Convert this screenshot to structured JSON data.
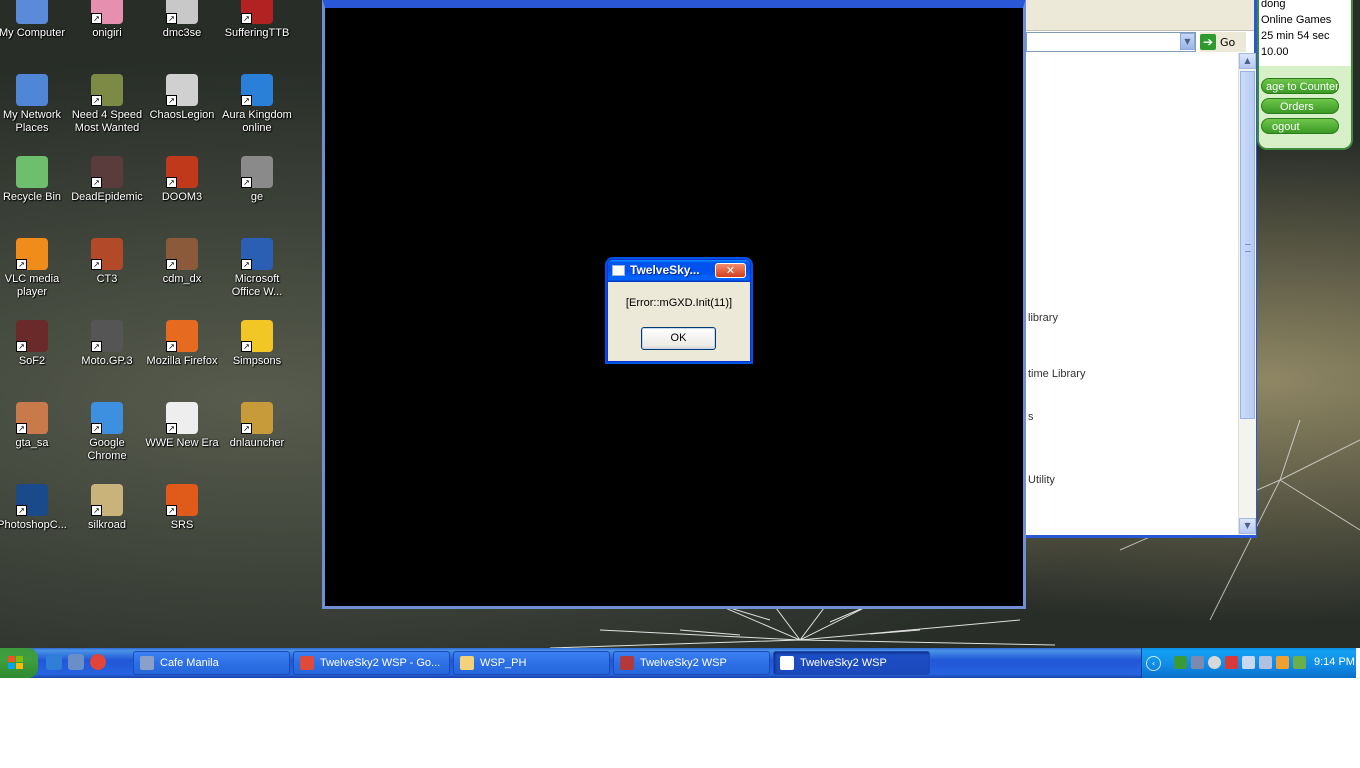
{
  "desktop": {
    "icons": [
      {
        "label": "My Computer",
        "icon": "my-computer-icon",
        "color": "#5b8bd8"
      },
      {
        "label": "onigiri",
        "icon": "onigiri-game-icon",
        "color": "#e78fae"
      },
      {
        "label": "dmc3se",
        "icon": "dmc3se-game-icon",
        "color": "#c8c8c8"
      },
      {
        "label": "SufferingTTB",
        "icon": "suffering-game-icon",
        "color": "#b22222"
      },
      {
        "label": "My Network Places",
        "icon": "network-places-icon",
        "color": "#4f86d6"
      },
      {
        "label": "Need 4 Speed Most Wanted",
        "icon": "nfs-game-icon",
        "color": "#7c8a46"
      },
      {
        "label": "ChaosLegion",
        "icon": "chaoslegion-game-icon",
        "color": "#d0d0d0"
      },
      {
        "label": "Aura Kingdom online",
        "icon": "aura-kingdom-game-icon",
        "color": "#2a7fd8"
      },
      {
        "label": "Recycle Bin",
        "icon": "recycle-bin-icon",
        "color": "#6dbf6d"
      },
      {
        "label": "DeadEpidemic",
        "icon": "deadepidemic-game-icon",
        "color": "#5a3c3c"
      },
      {
        "label": "DOOM3",
        "icon": "doom3-game-icon",
        "color": "#c0391b"
      },
      {
        "label": "ge",
        "icon": "ge-game-icon",
        "color": "#8a8a8a"
      },
      {
        "label": "VLC media player",
        "icon": "vlc-icon",
        "color": "#f08c1a"
      },
      {
        "label": "CT3",
        "icon": "ct3-game-icon",
        "color": "#b24a2a"
      },
      {
        "label": "cdm_dx",
        "icon": "cdm-dx-game-icon",
        "color": "#8a5a3a"
      },
      {
        "label": "Microsoft Office W...",
        "icon": "word-icon",
        "color": "#2b5fb4"
      },
      {
        "label": "SoF2",
        "icon": "sof2-game-icon",
        "color": "#6a2a2a"
      },
      {
        "label": "Moto.GP.3",
        "icon": "motogp-game-icon",
        "color": "#555555"
      },
      {
        "label": "Mozilla Firefox",
        "icon": "firefox-icon",
        "color": "#e66a1f"
      },
      {
        "label": "Simpsons",
        "icon": "simpsons-game-icon",
        "color": "#f2c624"
      },
      {
        "label": "gta_sa",
        "icon": "gta-sa-game-icon",
        "color": "#c97a4a"
      },
      {
        "label": "Google Chrome",
        "icon": "chrome-icon",
        "color": "#3d8fe0"
      },
      {
        "label": "WWE New Era",
        "icon": "wwe-game-icon",
        "color": "#eeeeee"
      },
      {
        "label": "dnlauncher",
        "icon": "dnlauncher-icon",
        "color": "#c79a3a"
      },
      {
        "label": "PhotoshopC...",
        "icon": "photoshop-icon",
        "color": "#1b4a8a"
      },
      {
        "label": "silkroad",
        "icon": "silkroad-game-icon",
        "color": "#c9b37a"
      },
      {
        "label": "SRS",
        "icon": "srs-game-icon",
        "color": "#e05a1a"
      }
    ]
  },
  "browser": {
    "go_label": "Go",
    "page_fragments": [
      "library",
      "time Library",
      "s",
      "Utility"
    ]
  },
  "cafe": {
    "user": "dong",
    "station": "Online Games",
    "time_left": "25 min 54 sec",
    "balance": "10.00",
    "buttons": [
      "age to Counter",
      "Orders",
      "ogout"
    ]
  },
  "dialog": {
    "title": "TwelveSky...",
    "message": "[Error::mGXD.Init(11)]",
    "ok_label": "OK",
    "close_glyph": "✕"
  },
  "taskbar": {
    "tasks": [
      {
        "label": "Cafe Manila",
        "icon": "cafe-manila-icon",
        "color": "#8aa0c8",
        "active": false
      },
      {
        "label": "TwelveSky2 WSP - Go...",
        "icon": "chrome-icon",
        "color": "#e04a3a",
        "active": false
      },
      {
        "label": "WSP_PH",
        "icon": "folder-icon",
        "color": "#f3d27a",
        "active": false
      },
      {
        "label": "TwelveSky2 WSP",
        "icon": "twelvesky-icon",
        "color": "#b23a3a",
        "active": false
      },
      {
        "label": "TwelveSky2 WSP",
        "icon": "window-icon",
        "color": "#ffffff",
        "active": true
      }
    ],
    "clock": "9:14 PM"
  },
  "colors": {
    "xp_blue": "#2157d7",
    "tray_blue": "#0f8ae6",
    "start_green": "#3e9e3e",
    "dialog_close_red": "#d1401d"
  }
}
